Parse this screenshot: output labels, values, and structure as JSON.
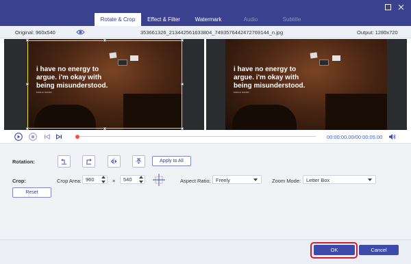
{
  "tabs": [
    {
      "label": "Rotate & Crop",
      "state": "active"
    },
    {
      "label": "Effect & Filter",
      "state": "normal"
    },
    {
      "label": "Watermark",
      "state": "normal"
    },
    {
      "label": "Audio",
      "state": "disabled"
    },
    {
      "label": "Subtitle",
      "state": "disabled"
    }
  ],
  "window_buttons": [
    "minimize-icon",
    "close-icon"
  ],
  "info": {
    "original": "Original: 960x540",
    "filename": "353661326_213442561633804_7493576442472769144_n.jpg",
    "output": "Output: 1280x720"
  },
  "preview": {
    "quote_left": "i have no energy to\nargue. i'm okay with\nbeing misunderstood.",
    "quote_right": "i have no energy to\nargue. i'm okay with\nbeing misunderstood.",
    "brand": "MUSIC MOOD"
  },
  "playback": {
    "time": "00:00:00.00/00:00:05.00",
    "position_fraction": 0.0
  },
  "rotation": {
    "label": "Rotation:",
    "apply_all": "Apply to All",
    "icons": [
      "rotate-left-icon",
      "rotate-right-icon",
      "flip-horizontal-icon",
      "flip-vertical-icon"
    ]
  },
  "crop": {
    "label": "Crop:",
    "area_label": "Crop Area:",
    "width": "960",
    "times": "×",
    "height": "540",
    "aspect_label": "Aspect Ratio:",
    "aspect_value": "Freely",
    "zoom_label": "Zoom Mode:",
    "zoom_value": "Letter Box",
    "reset": "Reset"
  },
  "footer": {
    "ok": "OK",
    "cancel": "Cancel"
  },
  "colors": {
    "brand": "#3a418f",
    "accent_button": "#3d4aa8",
    "crop_frame": "#f1e21a",
    "highlight": "#d01c2b",
    "timecode": "#3a60c8",
    "scrubber": "#f5533c"
  }
}
